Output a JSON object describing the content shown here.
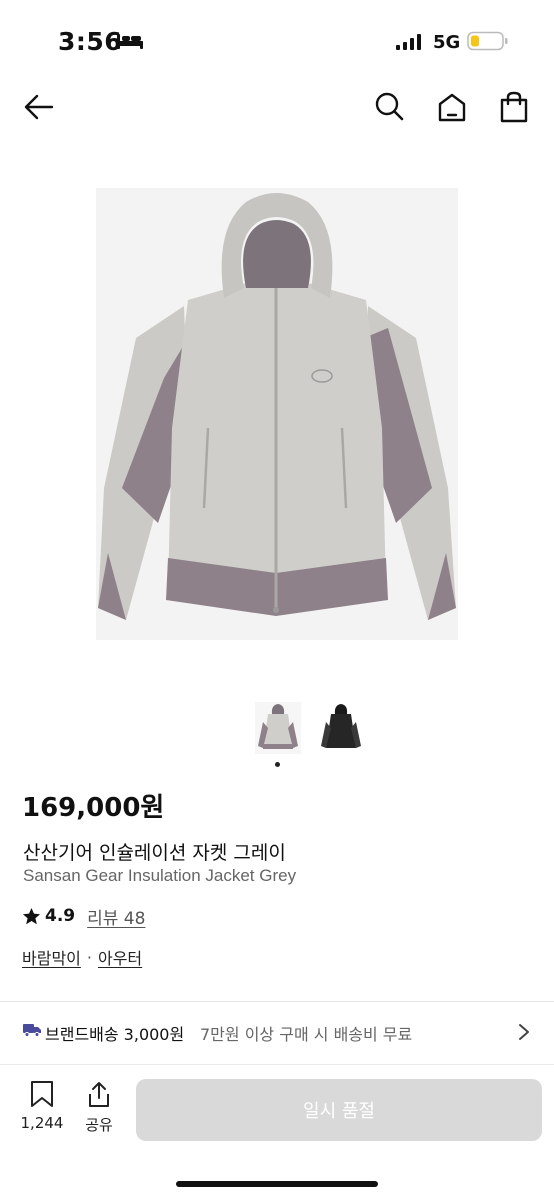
{
  "status_bar": {
    "time": "3:56",
    "network": "5G"
  },
  "header": {
    "icons": [
      "back-arrow-icon",
      "search-icon",
      "home-icon",
      "shopping-bag-icon"
    ]
  },
  "product": {
    "price": "169,000원",
    "title_ko": "산산기어 인슐레이션 자켓 그레이",
    "title_en": "Sansan Gear Insulation Jacket Grey",
    "rating": "4.9",
    "review_link": "리뷰 48",
    "categories": [
      "바람막이",
      "아우터"
    ],
    "category_separator": "·"
  },
  "shipping": {
    "label": "브랜드배송 3,000원",
    "note": "7만원 이상 구매 시 배송비 무료"
  },
  "bottom_bar": {
    "bookmark_count": "1,244",
    "share_label": "공유",
    "soldout_label": "일시 품절"
  },
  "colors": {
    "accent_icon": "#4a4a9c",
    "soldout_bg": "#d9d9d9",
    "jacket_light": "#c9c8c4",
    "jacket_mauve": "#8e8189"
  }
}
